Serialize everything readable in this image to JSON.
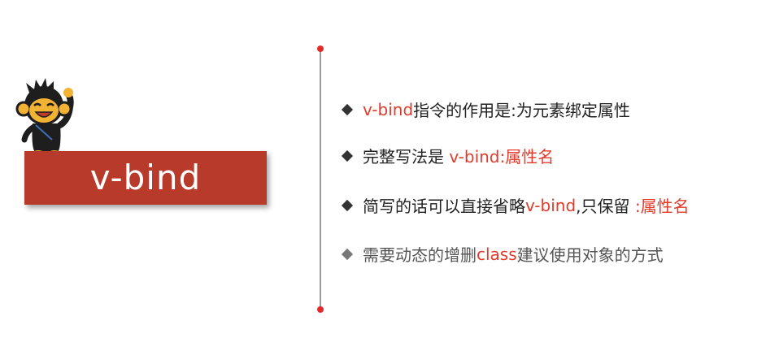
{
  "colors": {
    "banner": "#b73a2a",
    "accent_red": "#e23b2b",
    "divider": "#9a9a9a",
    "dot": "#e52a2a"
  },
  "mascot": {
    "icon": "monkey-mascot-icon"
  },
  "title": "v-bind",
  "bullets": [
    {
      "parts": [
        "v-bind",
        "指令的作用是:为元素绑定属性"
      ]
    },
    {
      "parts": [
        "完整写法是 ",
        "v-bind:属性名"
      ]
    },
    {
      "parts": [
        "简写的话可以直接省略",
        "v-bind",
        ",只保留 ",
        ":属性名"
      ]
    },
    {
      "parts": [
        "需要动态的增删",
        "class",
        "建议使用对象的方式"
      ]
    }
  ]
}
